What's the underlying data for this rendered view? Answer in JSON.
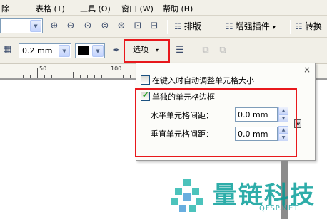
{
  "menubar": {
    "items": [
      {
        "label": "除"
      },
      {
        "label": "表格 (T)"
      },
      {
        "label": "工具 (O)"
      },
      {
        "label": "窗口 (W)"
      },
      {
        "label": "帮助 (H)"
      }
    ]
  },
  "toolbar1": {
    "paiban_label": "排版",
    "zengqiang_label": "增强插件",
    "zhuanhuan_label": "转换"
  },
  "toolbar2": {
    "line_width_value": "0.2 mm",
    "outline_color": "#000000",
    "options_label": "选项",
    "options_arrow": "▾"
  },
  "ruler": {
    "labels": [
      "50",
      "100"
    ]
  },
  "popup": {
    "close": "×",
    "auto_resize_label": "在键入时自动调整单元格大小",
    "auto_resize_checked": false,
    "separate_borders_label": "单独的单元格边框",
    "separate_borders_checked": true,
    "h_spacing_label": "水平单元格间距：",
    "h_spacing_value": "0.0 mm",
    "v_spacing_label": "垂直单元格间距：",
    "v_spacing_value": "0.0 mm"
  },
  "watermark": {
    "cn": "量链科技",
    "en": "QFSP.NET"
  },
  "colors": {
    "highlight_red": "#e8181c",
    "watermark_teal": "#009b96"
  }
}
